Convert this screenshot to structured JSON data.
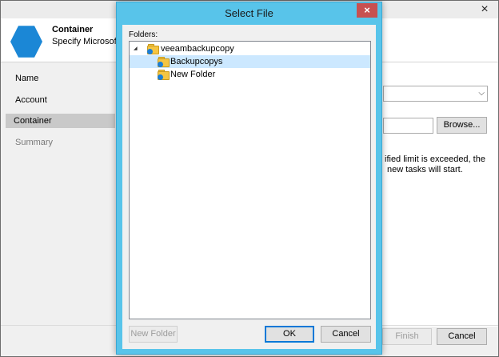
{
  "wizard": {
    "close_glyph": "×",
    "header_title": "Container",
    "header_subtitle": "Specify Microsoft A",
    "nav_items": [
      "Name",
      "Account",
      "Container",
      "Summary"
    ],
    "browse_label": "Browse...",
    "info_line1": "ified limit is exceeded, the",
    "info_line2": "new tasks will start.",
    "finish_label": "Finish",
    "cancel_label": "Cancel",
    "accent_color": "#1b87d6"
  },
  "dialog": {
    "title": "Select File",
    "close_glyph": "×",
    "folders_label": "Folders:",
    "tree": {
      "root": "veeambackupcopy",
      "children": [
        "Backupcopys",
        "New Folder"
      ],
      "selected": "Backupcopys"
    },
    "new_folder_label": "New Folder",
    "ok_label": "OK",
    "cancel_label": "Cancel",
    "frame_color": "#58c4ea",
    "close_color": "#c75050"
  }
}
